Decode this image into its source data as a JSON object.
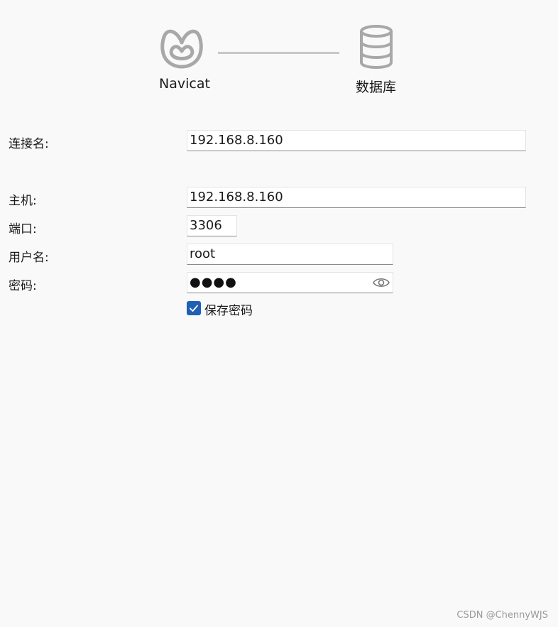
{
  "header": {
    "left_label": "Navicat",
    "right_label": "数据库",
    "left_icon": "navicat-logo-icon",
    "right_icon": "database-icon"
  },
  "form": {
    "connection_name": {
      "label": "连接名:",
      "value": "192.168.8.160"
    },
    "host": {
      "label": "主机:",
      "value": "192.168.8.160"
    },
    "port": {
      "label": "端口:",
      "value": "3306"
    },
    "username": {
      "label": "用户名:",
      "value": "root"
    },
    "password": {
      "label": "密码:",
      "masked_value": "●●●●"
    },
    "save_password": {
      "label": "保存密码",
      "checked": true
    }
  },
  "watermark": "CSDN @ChennyWJS",
  "colors": {
    "background": "#f9f9f9",
    "accent": "#1f5fb5",
    "icon_gray": "#a8a8a8"
  }
}
